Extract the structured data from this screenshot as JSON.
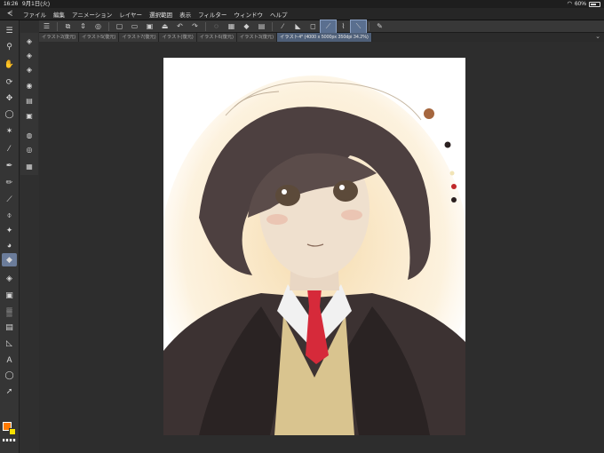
{
  "status": {
    "time": "16:26",
    "date": "9月1日(火)",
    "battery": "60%"
  },
  "menu": {
    "items": [
      "ファイル",
      "編集",
      "アニメーション",
      "レイヤー",
      "選択範囲",
      "表示",
      "フィルター",
      "ウィンドウ",
      "ヘルプ"
    ]
  },
  "tabs": [
    {
      "label": "イラスト2(復元)"
    },
    {
      "label": "イラスト5(復元)"
    },
    {
      "label": "イラスト7(復元)"
    },
    {
      "label": "イラスト(復元)"
    },
    {
      "label": "イラスト6(復元)"
    },
    {
      "label": "イラスト3(復元)"
    },
    {
      "label": "イラスト4* (4000 x 5000px 350dpi 34.2%)"
    }
  ],
  "colors": {
    "main": "#ff7a00",
    "sub": "#f6e000"
  },
  "icons": {
    "menu": "menu-icon",
    "undo": "undo-icon",
    "redo": "redo-icon",
    "settings": "gear-icon"
  }
}
